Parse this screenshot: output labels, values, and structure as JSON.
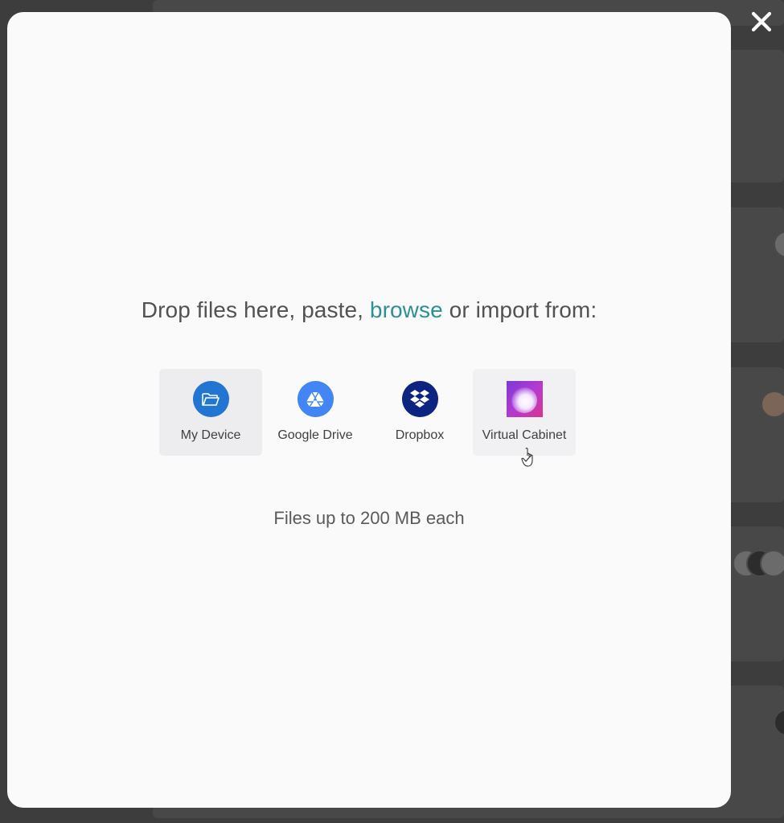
{
  "upload_modal": {
    "title_prefix": "Drop files here, paste,",
    "browse_link": "browse",
    "title_suffix": "or import from:",
    "sources": [
      {
        "label": "My Device",
        "icon": "folder-icon",
        "color": "#2276d2"
      },
      {
        "label": "Google Drive",
        "icon": "google-drive-icon",
        "color": "#4285f4"
      },
      {
        "label": "Dropbox",
        "icon": "dropbox-icon",
        "color": "#0d2481"
      },
      {
        "label": "Virtual Cabinet",
        "icon": "virtual-cabinet-icon",
        "color": "#9c3ad4"
      }
    ],
    "file_limit": "Files up to 200 MB each",
    "close_icon": "close-icon"
  },
  "colors": {
    "accent": "#2e8f95",
    "modal_background": "#fafafa",
    "overlay": "#3d3d3d"
  }
}
